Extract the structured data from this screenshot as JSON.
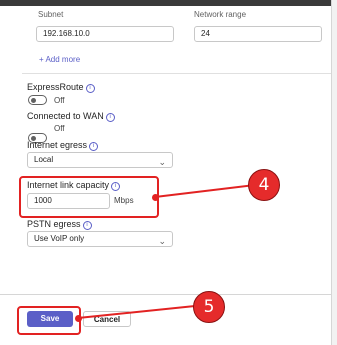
{
  "subnet_section": {
    "subnet_label": "Subnet",
    "network_range_label": "Network range",
    "subnet_value": "192.168.10.0",
    "network_range_value": "24",
    "add_more_label": "+ Add more"
  },
  "express_route": {
    "label": "ExpressRoute",
    "state": "Off"
  },
  "connected_to_wan": {
    "label": "Connected to WAN",
    "state": "Off"
  },
  "internet_egress": {
    "label": "Internet egress",
    "value": "Local"
  },
  "internet_link_capacity": {
    "label": "Internet link capacity",
    "value": "1000",
    "unit": "Mbps"
  },
  "pstn_egress": {
    "label": "PSTN egress",
    "value": "Use VoIP only"
  },
  "footer": {
    "save_label": "Save",
    "cancel_label": "Cancel"
  },
  "annotations": {
    "step_4": "4",
    "step_5": "5",
    "callout_color": "#e22222"
  },
  "colors": {
    "accent": "#5b5fc7"
  }
}
